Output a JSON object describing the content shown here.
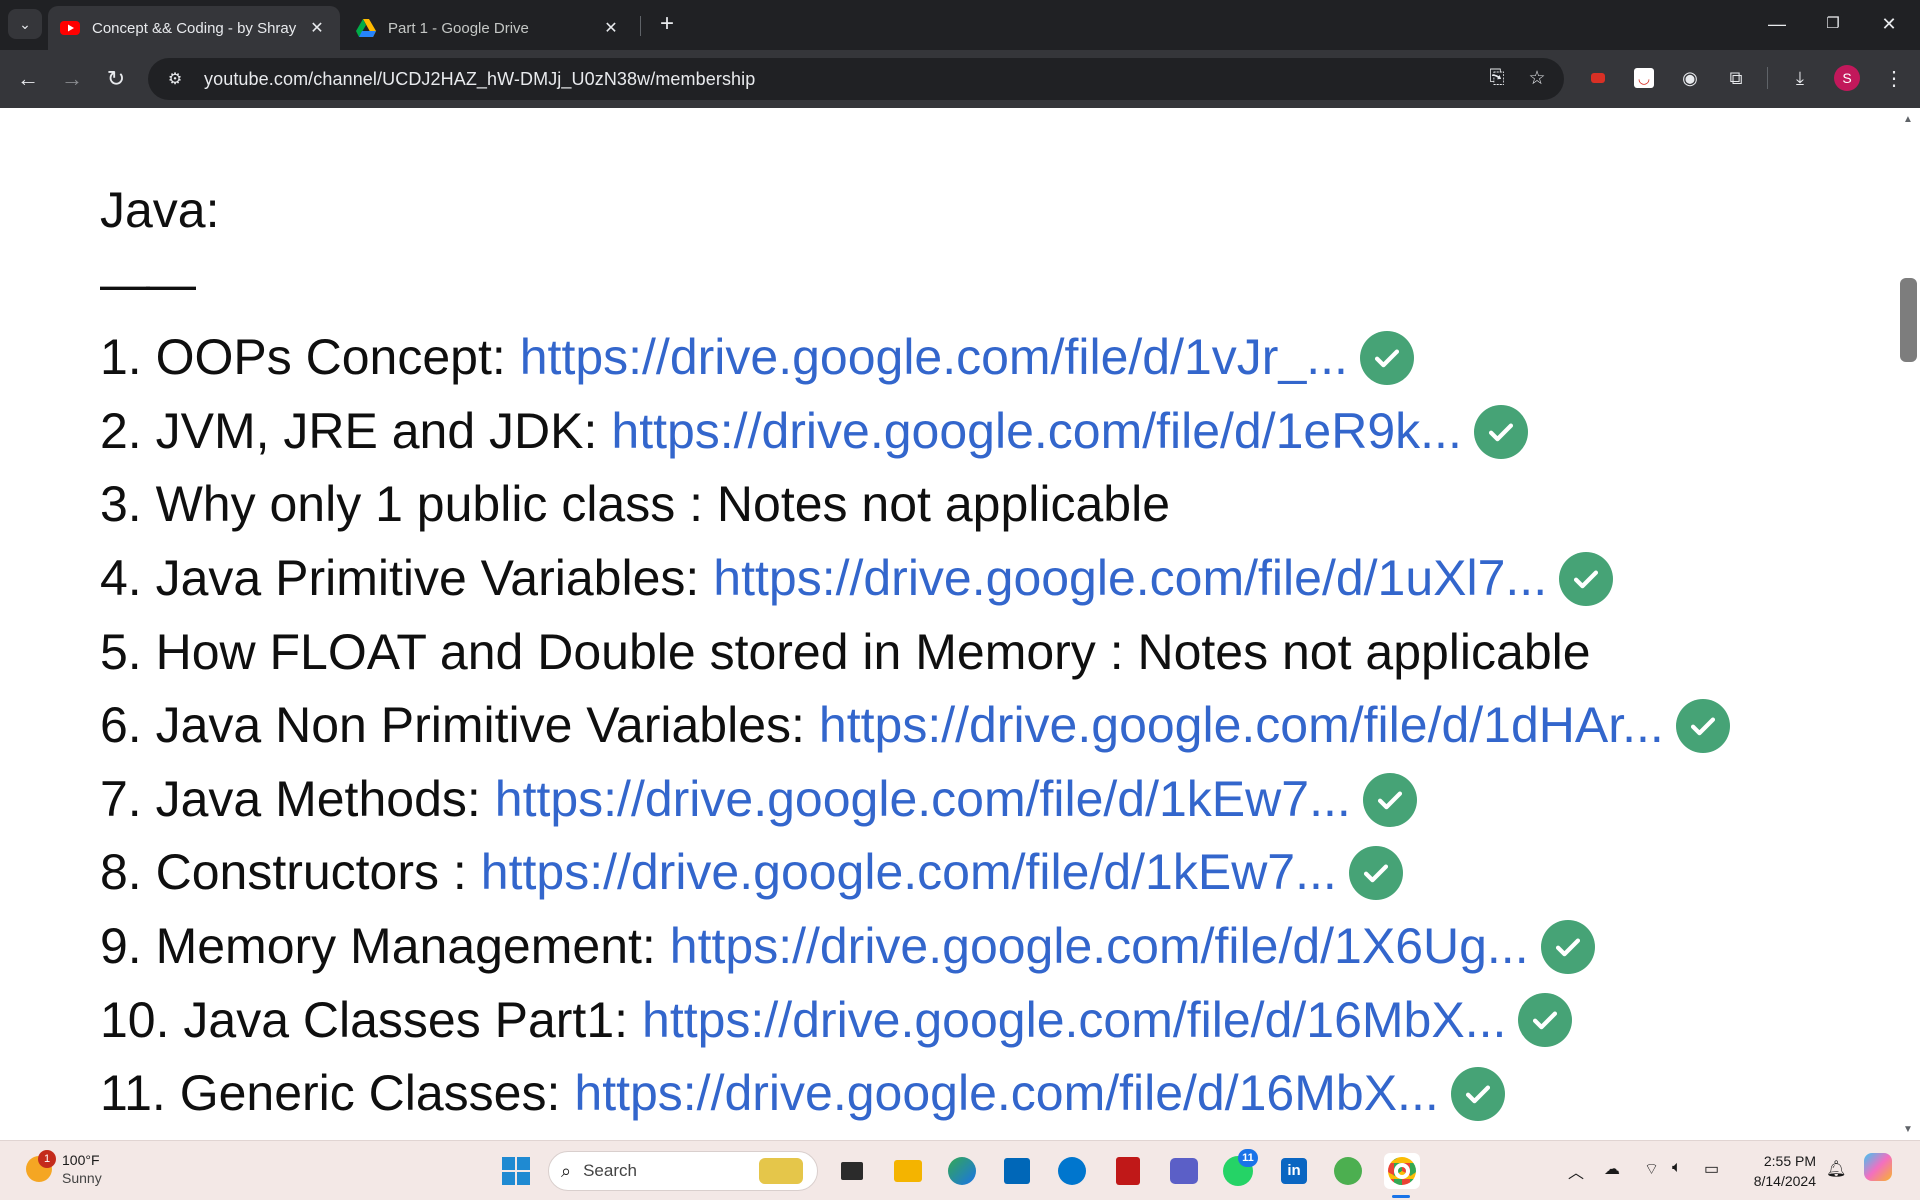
{
  "browser": {
    "tabs": [
      {
        "title": "Concept && Coding - by Shray",
        "favicon": "youtube-icon",
        "active": true
      },
      {
        "title": "Part 1 - Google Drive",
        "favicon": "google-drive-icon",
        "active": false
      }
    ],
    "url": "youtube.com/channel/UCDJ2HAZ_hW-DMJj_U0zN38w/membership",
    "profile_initial": "S"
  },
  "content": {
    "heading": "Java:",
    "rule": "——",
    "items": [
      {
        "label": "1. OOPs Concept:",
        "link": "https://drive.google.com/file/d/1vJr_...",
        "checked": true
      },
      {
        "label": "2. JVM, JRE and JDK:",
        "link": "https://drive.google.com/file/d/1eR9k...",
        "checked": true
      },
      {
        "label": "3. Why only 1 public class : Notes not applicable",
        "link": "",
        "checked": false
      },
      {
        "label": "4. Java Primitive Variables:",
        "link": "https://drive.google.com/file/d/1uXl7...",
        "checked": true
      },
      {
        "label": "5. How FLOAT and Double stored in Memory : Notes not applicable",
        "link": "",
        "checked": false
      },
      {
        "label": "6. Java Non Primitive Variables:",
        "link": "https://drive.google.com/file/d/1dHAr...",
        "checked": true
      },
      {
        "label": "7. Java Methods:",
        "link": "https://drive.google.com/file/d/1kEw7...",
        "checked": true
      },
      {
        "label": "8. Constructors :",
        "link": "https://drive.google.com/file/d/1kEw7...",
        "checked": true
      },
      {
        "label": "9. Memory Management:",
        "link": "https://drive.google.com/file/d/1X6Ug...",
        "checked": true
      },
      {
        "label": "10. Java Classes Part1:",
        "link": "https://drive.google.com/file/d/16MbX...",
        "checked": true
      },
      {
        "label": "11. Generic Classes:",
        "link": "https://drive.google.com/file/d/16MbX...",
        "checked": true
      }
    ]
  },
  "taskbar": {
    "weather_temp": "100°F",
    "weather_cond": "Sunny",
    "weather_badge": "1",
    "search_placeholder": "Search",
    "whatsapp_badge": "11",
    "time": "2:55 PM",
    "date": "8/14/2024"
  }
}
